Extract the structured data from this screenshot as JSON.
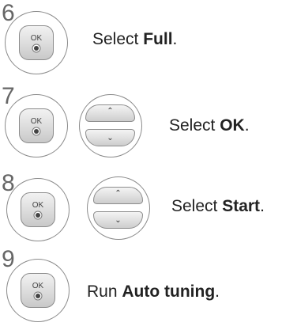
{
  "steps": [
    {
      "number": "6",
      "prefix": "Select ",
      "bold": "Full",
      "suffix": ".",
      "ok_label": "OK",
      "has_nav": false
    },
    {
      "number": "7",
      "prefix": "Select ",
      "bold": "OK",
      "suffix": ".",
      "ok_label": "OK",
      "has_nav": true
    },
    {
      "number": "8",
      "prefix": "Select ",
      "bold": "Start",
      "suffix": ".",
      "ok_label": "OK",
      "has_nav": true
    },
    {
      "number": "9",
      "prefix": "Run ",
      "bold": "Auto tuning",
      "suffix": ".",
      "ok_label": "OK",
      "has_nav": false
    }
  ],
  "icons": {
    "ok": "ok-button-icon",
    "up": "up-arrow-icon",
    "down": "down-arrow-icon"
  },
  "colors": {
    "text": "#222222",
    "step_number": "#666666",
    "outline": "#8a8a8a"
  }
}
